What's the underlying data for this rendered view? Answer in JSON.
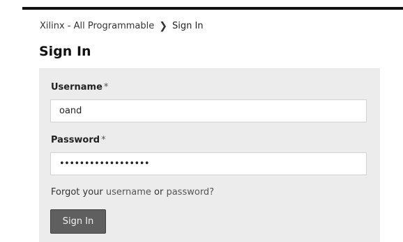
{
  "breadcrumb": {
    "items": [
      "Xilinx - All Programmable",
      "Sign In"
    ],
    "separator": "❯"
  },
  "page": {
    "title": "Sign In"
  },
  "form": {
    "username": {
      "label": "Username",
      "required_mark": "*",
      "value": "oand"
    },
    "password": {
      "label": "Password",
      "required_mark": "*",
      "value": "••••••••••••••••••"
    },
    "forgot": {
      "prefix": "Forgot your ",
      "username_link": "username",
      "middle": " or ",
      "password_link": "password?"
    },
    "submit_label": "Sign In"
  },
  "colors": {
    "panel_bg": "#ececec",
    "button_bg": "#5f5f5f",
    "top_rule": "#111111"
  }
}
